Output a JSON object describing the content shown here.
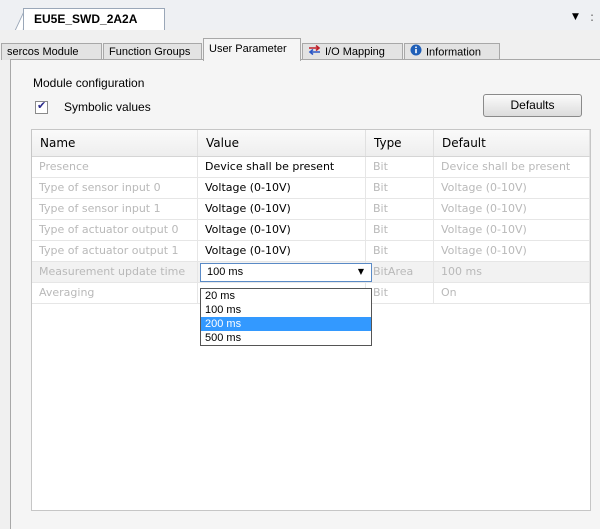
{
  "document": {
    "tab_title": "EU5E_SWD_2A2A"
  },
  "tabs": [
    {
      "label": "sercos Module"
    },
    {
      "label": "Function Groups"
    },
    {
      "label": "User Parameter"
    },
    {
      "label": "I/O Mapping"
    },
    {
      "label": "Information"
    }
  ],
  "section": {
    "title": "Module configuration"
  },
  "symbolic": {
    "label": "Symbolic values",
    "checked": true
  },
  "defaults_button": "Defaults",
  "grid": {
    "columns": [
      "Name",
      "Value",
      "Type",
      "Default"
    ],
    "rows": [
      {
        "name": "Presence",
        "value": "Device shall be present",
        "type": "Bit",
        "default": "Device shall be present"
      },
      {
        "name": "Type of sensor input 0",
        "value": "Voltage (0-10V)",
        "type": "Bit",
        "default": "Voltage (0-10V)"
      },
      {
        "name": "Type of sensor input 1",
        "value": "Voltage (0-10V)",
        "type": "Bit",
        "default": "Voltage (0-10V)"
      },
      {
        "name": "Type of actuator output 0",
        "value": "Voltage (0-10V)",
        "type": "Bit",
        "default": "Voltage (0-10V)"
      },
      {
        "name": "Type of actuator output 1",
        "value": "Voltage (0-10V)",
        "type": "Bit",
        "default": "Voltage (0-10V)"
      },
      {
        "name": "Measurement update time",
        "value": "100 ms",
        "type": "BitArea",
        "default": "100 ms"
      },
      {
        "name": "Averaging",
        "value": "",
        "type": "Bit",
        "default": "On"
      }
    ]
  },
  "dropdown": {
    "selected_value": "100 ms",
    "options": [
      "20 ms",
      "100 ms",
      "200 ms",
      "500 ms"
    ],
    "highlighted_index": 2
  },
  "icons": {
    "io_mapping": "io-mapping-arrows-icon",
    "information": "info-circle-icon",
    "accent": "#2b56c6",
    "highlight": "#3399ff"
  }
}
